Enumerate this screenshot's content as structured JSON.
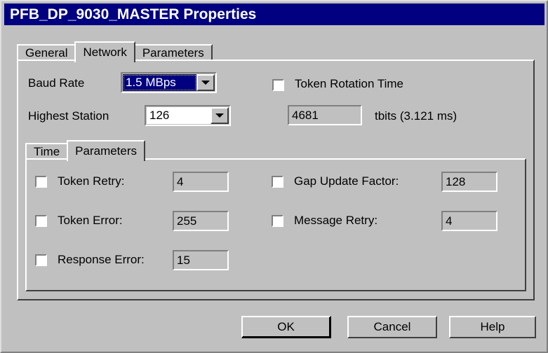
{
  "window": {
    "title": "PFB_DP_9030_MASTER Properties"
  },
  "outer_tabs": [
    {
      "label": "General",
      "active": false
    },
    {
      "label": "Network",
      "active": true
    },
    {
      "label": "Parameters",
      "active": false
    }
  ],
  "network": {
    "baud_rate": {
      "label": "Baud Rate",
      "value": "1.5 MBps",
      "focused": true
    },
    "highest_station": {
      "label": "Highest Station",
      "value": "126",
      "focused": false
    },
    "token_rotation_time": {
      "label": "Token Rotation Time",
      "checked": false,
      "value": "4681",
      "units": "tbits (3.121 ms)"
    }
  },
  "inner_tabs": [
    {
      "label": "Time",
      "active": false
    },
    {
      "label": "Parameters",
      "active": true
    }
  ],
  "parameters": {
    "left": [
      {
        "label": "Token Retry:",
        "checked": false,
        "value": "4"
      },
      {
        "label": "Token Error:",
        "checked": false,
        "value": "255"
      },
      {
        "label": "Response Error:",
        "checked": false,
        "value": "15"
      }
    ],
    "right": [
      {
        "label": "Gap Update Factor:",
        "checked": false,
        "value": "128"
      },
      {
        "label": "Message Retry:",
        "checked": false,
        "value": "4"
      }
    ]
  },
  "buttons": {
    "ok": "OK",
    "cancel": "Cancel",
    "help": "Help"
  },
  "colors": {
    "titlebar": "#000080",
    "face": "#c0c0c0",
    "highlight": "#000080",
    "text": "#000000"
  }
}
